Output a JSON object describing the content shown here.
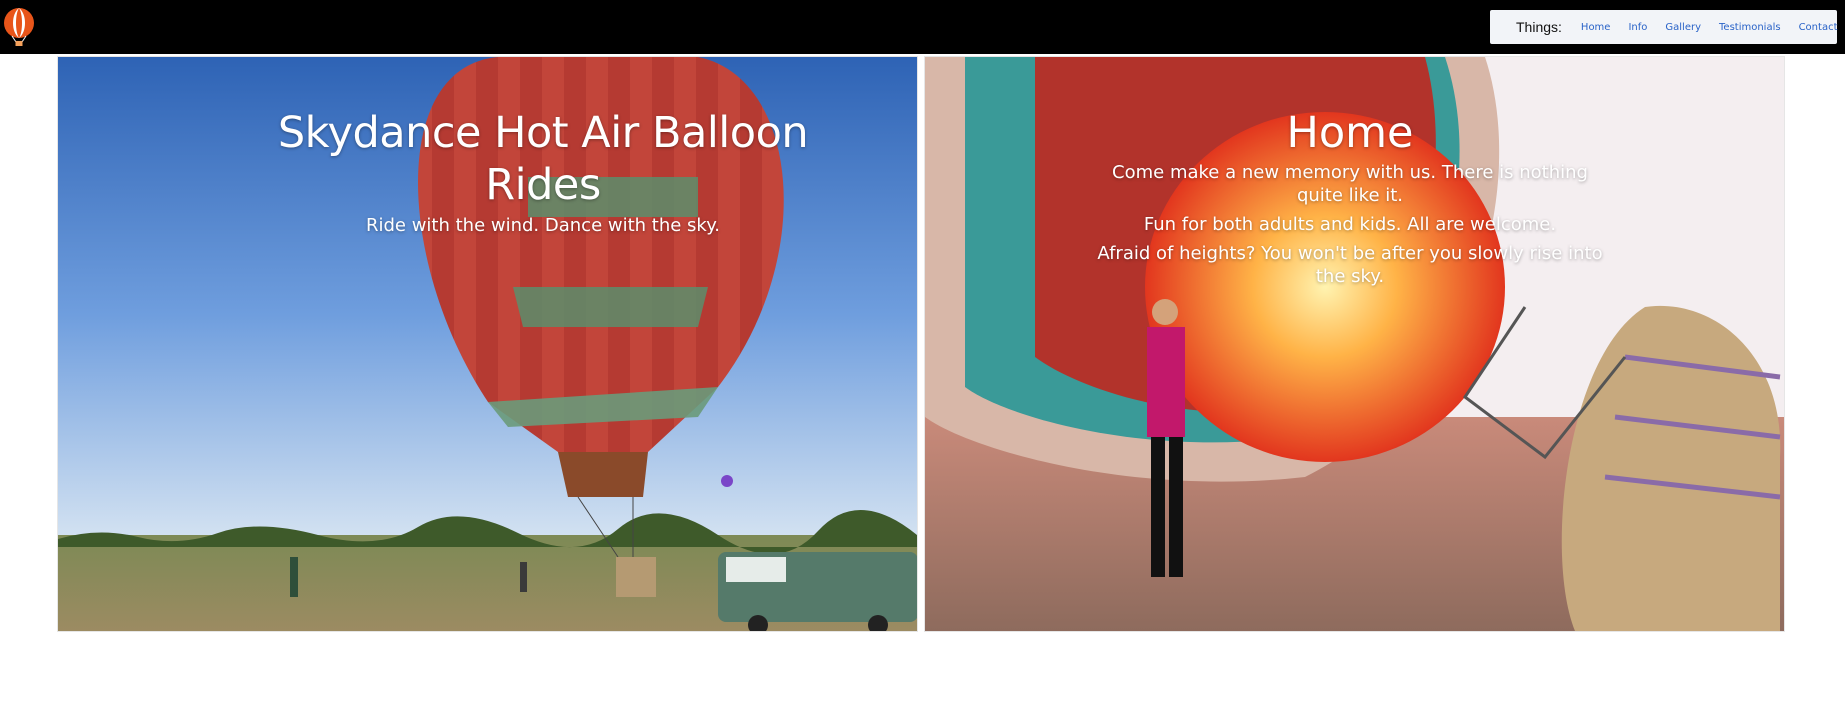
{
  "nav": {
    "label": "Things:",
    "links": [
      "Home",
      "Info",
      "Gallery",
      "Testimonials",
      "Contact"
    ]
  },
  "hero": {
    "title": "Skydance Hot Air Balloon Rides",
    "subtitle": "Ride with the wind. Dance with the sky."
  },
  "home": {
    "title": "Home",
    "lines": [
      "Come make a new memory with us. There is nothing quite like it.",
      "Fun for both adults and kids. All are welcome.",
      "Afraid of heights? You won't be after you slowly rise into the sky."
    ]
  },
  "colors": {
    "topbar": "#000000",
    "nav_link": "#2a63c8",
    "logo_orange": "#e8551a"
  },
  "icons": {
    "logo": "hot-air-balloon-logo"
  }
}
